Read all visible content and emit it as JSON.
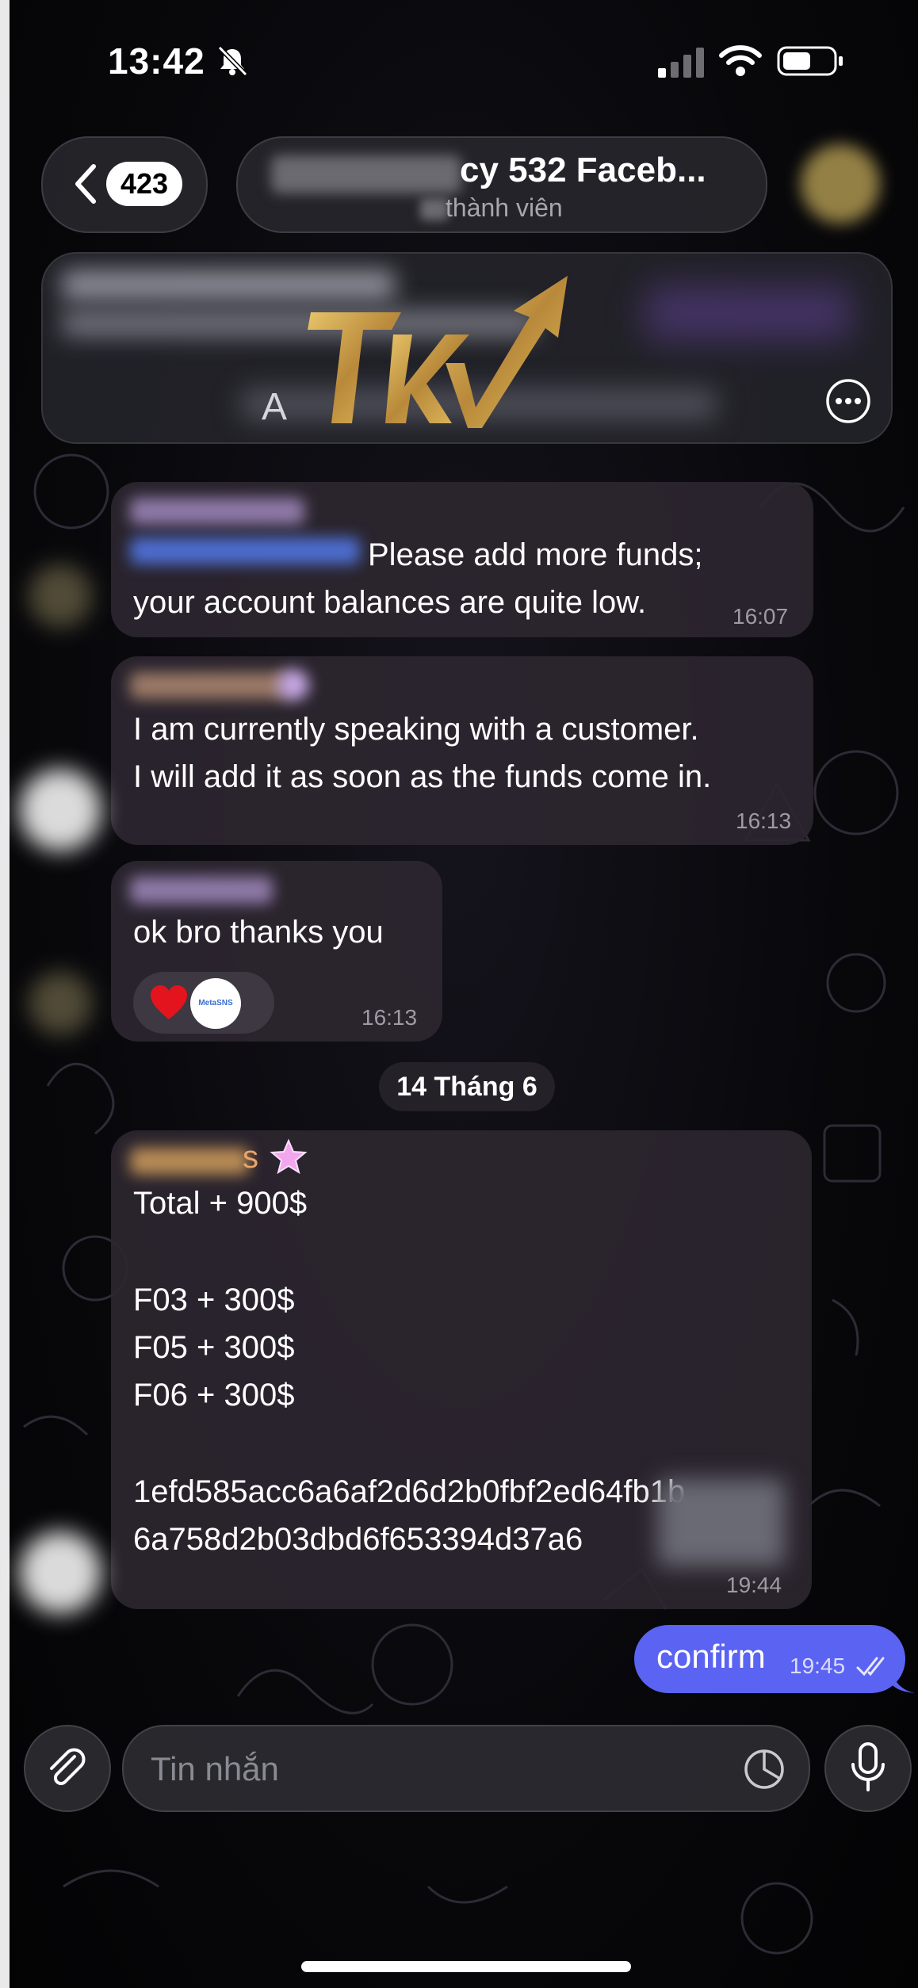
{
  "status_bar": {
    "time": "13:42"
  },
  "header": {
    "back_count": "423",
    "title": "cy 532 Faceb...",
    "subtitle": "thành viên"
  },
  "pinned": {
    "preview_letter": "A"
  },
  "messages": [
    {
      "line1": "Please add more funds;",
      "line2": "your account balances are quite low.",
      "time": "16:07"
    },
    {
      "line1": "I am currently speaking with a customer.",
      "line2": "I will add it as soon as the funds come in.",
      "time": "16:13"
    },
    {
      "line1": "ok bro thanks you",
      "time": "16:13",
      "reactions": [
        "heart",
        "MetaSNS"
      ]
    },
    {
      "sender_suffix": "s",
      "lines": [
        "Total + 900$",
        "",
        "F03 + 300$",
        "F05 + 300$",
        "F06 + 300$",
        "",
        "1efd585acc6a6af2d6d2b0fbf2ed64fb1b",
        "6a758d2b03dbd6f653394d37a6"
      ],
      "time": "19:44"
    }
  ],
  "date_separator": "14 Tháng 6",
  "outgoing": {
    "text": "confirm",
    "time": "19:45"
  },
  "composer": {
    "placeholder": "Tin nhắn"
  },
  "colors": {
    "outgoing_bubble": "#5b63f2",
    "incoming_bubble": "#2c2630",
    "logo_gold": "#c9a44a"
  }
}
